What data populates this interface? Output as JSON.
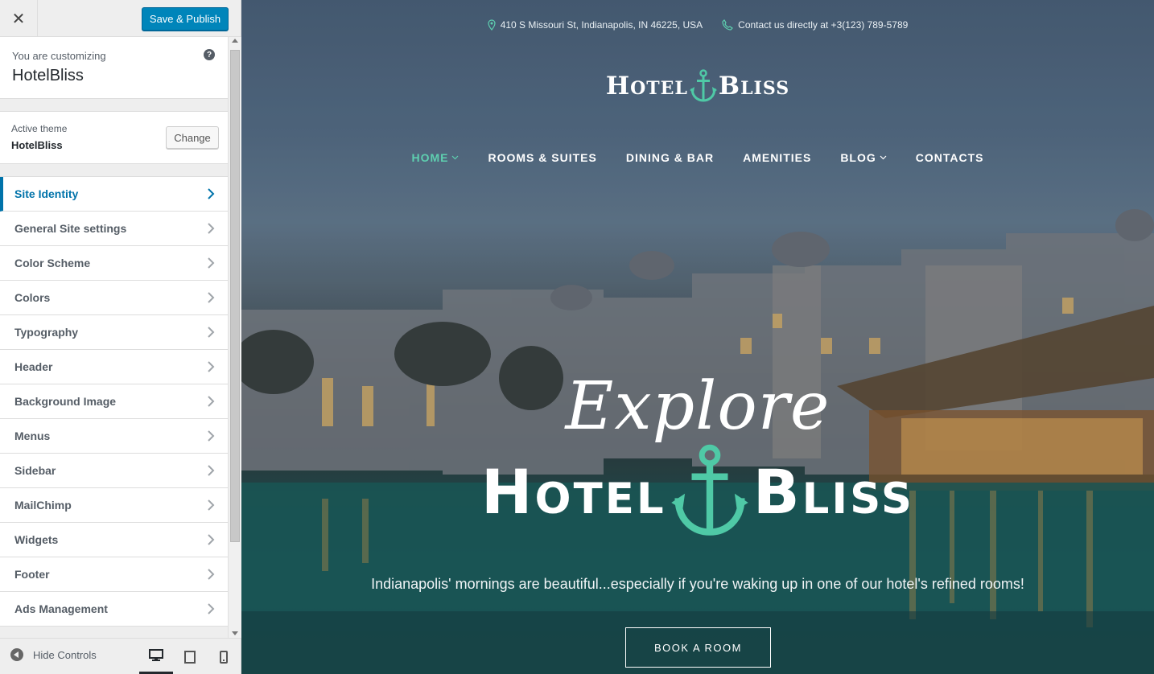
{
  "customizer": {
    "close_icon": "close-icon",
    "publish_label": "Save & Publish",
    "customizing_label": "You are customizing",
    "site_name": "HotelBliss",
    "active_theme_label": "Active theme",
    "active_theme_name": "HotelBliss",
    "change_label": "Change",
    "panels": [
      {
        "label": "Site Identity",
        "active": true
      },
      {
        "label": "General Site settings"
      },
      {
        "label": "Color Scheme"
      },
      {
        "label": "Colors"
      },
      {
        "label": "Typography"
      },
      {
        "label": "Header"
      },
      {
        "label": "Background Image"
      },
      {
        "label": "Menus"
      },
      {
        "label": "Sidebar"
      },
      {
        "label": "MailChimp"
      },
      {
        "label": "Widgets"
      },
      {
        "label": "Footer"
      },
      {
        "label": "Ads Management"
      }
    ],
    "hide_controls_label": "Hide Controls",
    "devices": [
      "desktop",
      "tablet",
      "mobile"
    ],
    "colors": {
      "primary": "#0085ba",
      "active": "#0073aa"
    }
  },
  "preview": {
    "address": "410 S Missouri St, Indianapolis, IN 46225, USA",
    "contact": "Contact us directly at +3(123) 789-5789",
    "logo_word1": "Hotel",
    "logo_word2": "Bliss",
    "nav": [
      {
        "label": "HOME",
        "active": true,
        "has_dropdown": true
      },
      {
        "label": "ROOMS & SUITES"
      },
      {
        "label": "DINING & BAR"
      },
      {
        "label": "AMENITIES"
      },
      {
        "label": "BLOG",
        "has_dropdown": true
      },
      {
        "label": "CONTACTS"
      }
    ],
    "hero_script": "Explore",
    "hero_word1": "Hotel",
    "hero_word2": "Bliss",
    "tagline": "Indianapolis' mornings are beautiful...especially if you're waking up in one of our hotel's refined rooms!",
    "book_label": "BOOK A ROOM",
    "accent_color": "#4fc9a6"
  }
}
